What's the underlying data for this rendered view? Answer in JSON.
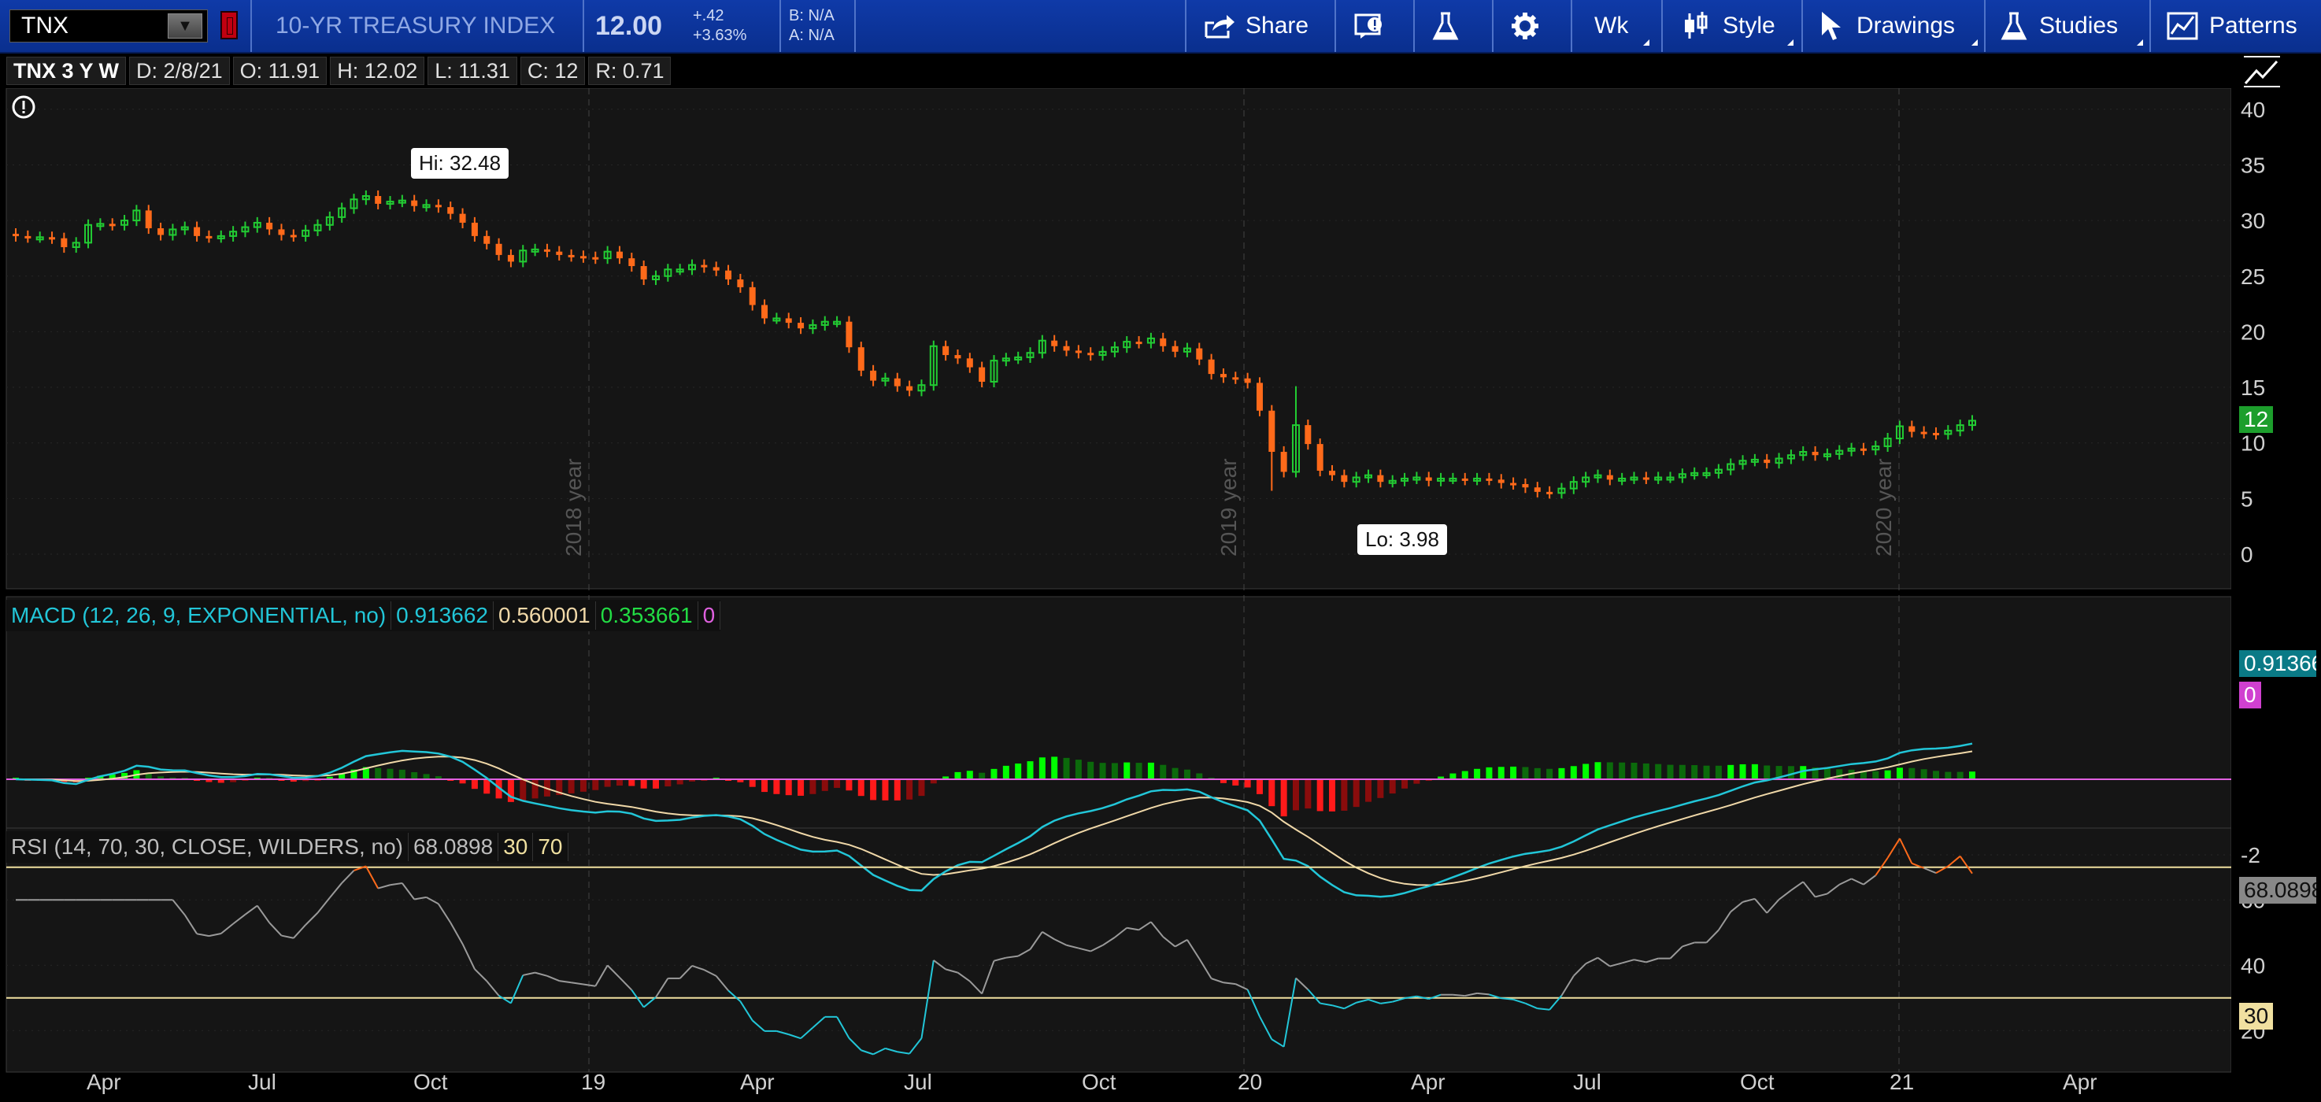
{
  "toolbar": {
    "symbol": "TNX",
    "description": "10-YR TREASURY INDEX",
    "last": "12.00",
    "net_change": "+.42",
    "pct_change": "+3.63%",
    "bid": "B: N/A",
    "ask": "A: N/A",
    "share_label": "Share",
    "timeframe_label": "Wk",
    "style_label": "Style",
    "drawings_label": "Drawings",
    "studies_label": "Studies",
    "patterns_label": "Patterns"
  },
  "header": {
    "title": "TNX 3 Y W",
    "date": "D: 2/8/21",
    "open": "O: 11.91",
    "high": "H: 12.02",
    "low": "L: 11.31",
    "close": "C: 12",
    "range": "R: 0.71"
  },
  "price": {
    "hi_label": "Hi: 32.48",
    "lo_label": "Lo: 3.98",
    "current_tag": "12",
    "y_ticks": [
      "40",
      "35",
      "30",
      "25",
      "20",
      "15",
      "10",
      "5",
      "0"
    ],
    "year_labels": [
      "2018 year",
      "2019 year",
      "2020 year"
    ]
  },
  "macd": {
    "title": "MACD (12, 26, 9, EXPONENTIAL, no)",
    "value": "0.913662",
    "avg": "0.560001",
    "diff": "0.353661",
    "zero": "0",
    "value_tag": "0.91366",
    "zero_tag": "0",
    "y_ticks": [
      "-2"
    ]
  },
  "rsi": {
    "title": "RSI (14, 70, 30, CLOSE, WILDERS, no)",
    "value": "68.0898",
    "oversold": "30",
    "overbought": "70",
    "value_tag": "68.0898",
    "os_tag": "30",
    "y_ticks": [
      "60",
      "40",
      "20"
    ]
  },
  "x_axis": [
    "Apr",
    "Jul",
    "Oct",
    "19",
    "Apr",
    "Jul",
    "Oct",
    "20",
    "Apr",
    "Jul",
    "Oct",
    "21",
    "Apr"
  ],
  "colors": {
    "up": "#22cc33",
    "down": "#ff6a1a",
    "macd_value": "#22c6d8",
    "macd_avg": "#f0d8a8",
    "hist_up_strong": "#00ff00",
    "hist_up_weak": "#0b6a0b",
    "hist_down_strong": "#ff1a1a",
    "hist_down_weak": "#8a0c0c",
    "zero_line": "#e060e0",
    "rsi_line": "#9a9a9a",
    "rsi_os": "#22c6d8",
    "rsi_ob": "#ff6a1a",
    "band": "#f0e0a0"
  },
  "chart_data": {
    "type": "candlestick",
    "interval": "weekly",
    "period": "3 years",
    "close": [
      28.6,
      28.5,
      28.5,
      28.4,
      27.6,
      28.0,
      29.6,
      29.7,
      29.6,
      30.0,
      30.9,
      29.3,
      28.7,
      29.2,
      29.4,
      28.6,
      28.5,
      28.6,
      29.0,
      29.4,
      29.8,
      29.2,
      28.7,
      28.6,
      29.1,
      29.6,
      30.3,
      31.1,
      31.9,
      32.2,
      31.5,
      31.7,
      31.8,
      31.3,
      31.4,
      31.2,
      30.6,
      29.8,
      28.6,
      27.9,
      26.9,
      26.3,
      27.3,
      27.4,
      27.2,
      26.9,
      26.8,
      26.7,
      26.6,
      27.2,
      26.6,
      25.9,
      24.7,
      25.0,
      25.6,
      25.6,
      26.0,
      25.8,
      25.5,
      24.7,
      24.0,
      22.4,
      21.2,
      21.2,
      20.8,
      20.3,
      20.6,
      20.9,
      20.9,
      18.6,
      16.5,
      15.6,
      15.8,
      15.1,
      14.7,
      15.2,
      18.7,
      17.9,
      17.6,
      16.8,
      15.5,
      17.4,
      17.6,
      17.7,
      18.1,
      19.2,
      18.7,
      18.3,
      18.1,
      17.9,
      18.2,
      18.6,
      19.1,
      19.0,
      19.4,
      18.7,
      18.2,
      18.5,
      17.5,
      16.2,
      15.9,
      15.8,
      15.4,
      12.9,
      9.2,
      7.4,
      11.6,
      9.9,
      7.5,
      7.1,
      6.5,
      6.9,
      7.1,
      6.5,
      6.6,
      6.8,
      6.9,
      6.6,
      6.8,
      6.8,
      6.7,
      6.8,
      6.7,
      6.4,
      6.3,
      6.0,
      5.6,
      5.5,
      5.9,
      6.5,
      6.9,
      7.1,
      6.7,
      6.8,
      6.9,
      6.8,
      6.9,
      6.9,
      7.2,
      7.3,
      7.3,
      7.6,
      8.1,
      8.4,
      8.5,
      8.2,
      8.6,
      8.9,
      9.2,
      8.9,
      9.0,
      9.3,
      9.5,
      9.4,
      9.7,
      10.4,
      11.5,
      11.0,
      10.9,
      10.8,
      11.1,
      11.6,
      12.0
    ],
    "high": 32.48,
    "low": 3.98,
    "x_range": [
      "2018-02",
      "2021-02"
    ],
    "y_range": [
      -3,
      42
    ]
  }
}
